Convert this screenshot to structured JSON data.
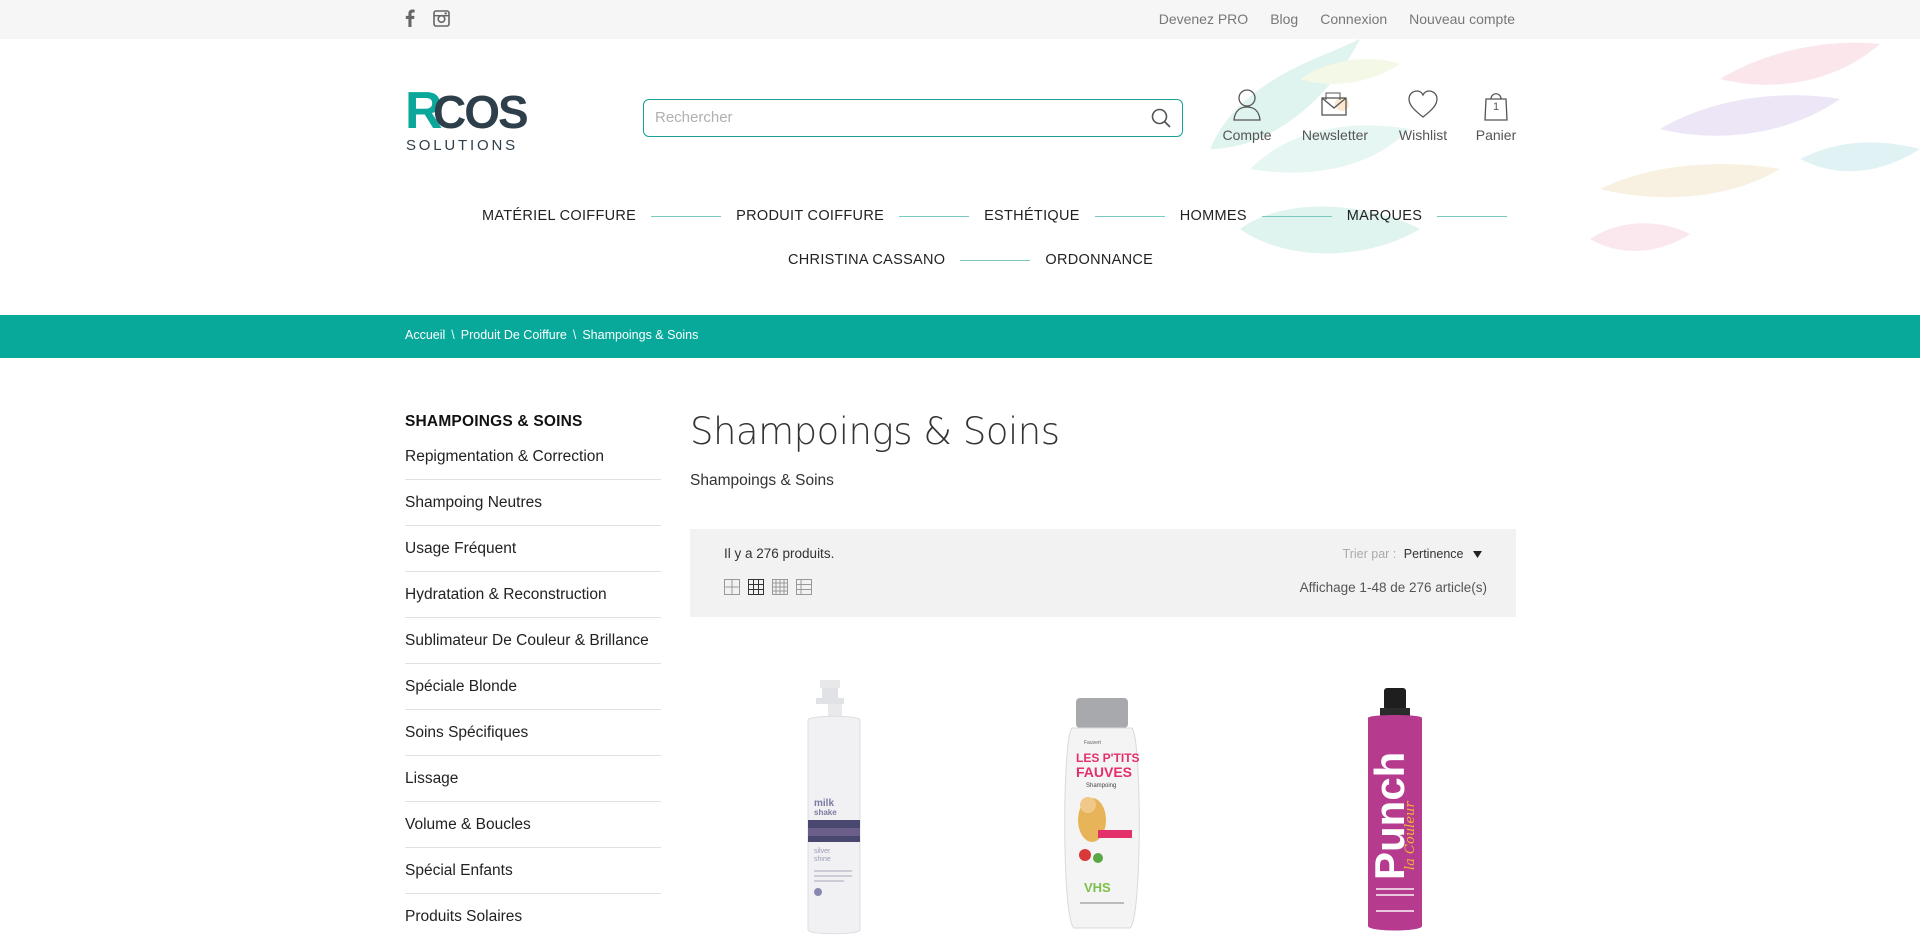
{
  "topbar": {
    "social": [
      {
        "icon": "facebook-icon"
      },
      {
        "icon": "instagram-icon"
      }
    ],
    "links": [
      "Devenez PRO",
      "Blog",
      "Connexion",
      "Nouveau compte"
    ]
  },
  "header": {
    "logo_text": "RCOS SOLUTIONS",
    "search": {
      "placeholder": "Rechercher",
      "value": ""
    },
    "icons": [
      {
        "label": "Compte",
        "icon": "user-icon"
      },
      {
        "label": "Newsletter",
        "icon": "envelope-icon"
      },
      {
        "label": "Wishlist",
        "icon": "heart-icon"
      },
      {
        "label": "Panier",
        "icon": "bag-icon",
        "badge": "1"
      }
    ]
  },
  "nav": {
    "row1": [
      "MATÉRIEL COIFFURE",
      "PRODUIT COIFFURE",
      "ESTHÉTIQUE",
      "HOMMES",
      "MARQUES"
    ],
    "row2": [
      "CHRISTINA CASSANO",
      "ORDONNANCE"
    ]
  },
  "breadcrumb": [
    "Accueil",
    "Produit De Coiffure",
    "Shampoings & Soins"
  ],
  "sidebar": {
    "title": "SHAMPOINGS & SOINS",
    "items": [
      "Repigmentation & Correction",
      "Shampoing Neutres",
      "Usage Fréquent",
      "Hydratation & Reconstruction",
      "Sublimateur De Couleur & Brillance",
      "Spéciale Blonde",
      "Soins Spécifiques",
      "Lissage",
      "Volume & Boucles",
      "Spécial Enfants",
      "Produits Solaires"
    ]
  },
  "content": {
    "title": "Shampoings & Soins",
    "subtitle": "Shampoings & Soins",
    "count_text": "Il y a 276 produits.",
    "sort_label": "Trier par :",
    "sort_value": "Pertinence",
    "showing_text": "Affichage 1-48 de 276 article(s)"
  },
  "colors": {
    "accent": "#08a89b",
    "search_border": "#1a9f96",
    "nav_line": "#78c9c2"
  }
}
